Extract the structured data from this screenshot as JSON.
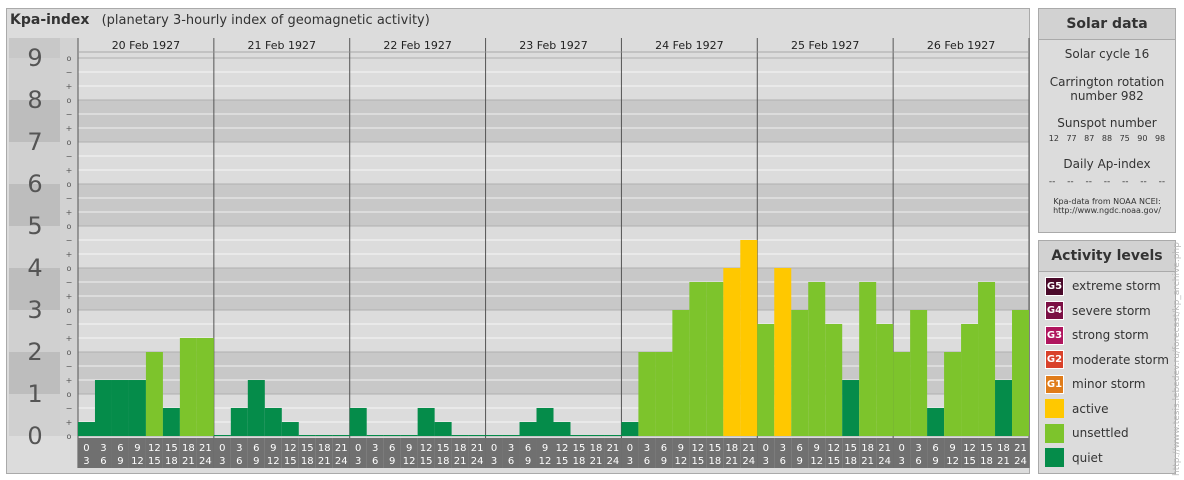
{
  "header": {
    "title": "Kpa-index",
    "subtitle": "(planetary 3-hourly index of geomagnetic activity)"
  },
  "chart_data": {
    "type": "bar",
    "ylim": [
      0,
      9
    ],
    "y_major_ticks": [
      "0",
      "1",
      "2",
      "3",
      "4",
      "5",
      "6",
      "7",
      "8",
      "9"
    ],
    "y_minor_ticks": [
      "o",
      "+",
      "−"
    ],
    "days": [
      "20 Feb 1927",
      "21 Feb 1927",
      "22 Feb 1927",
      "23 Feb 1927",
      "24 Feb 1927",
      "25 Feb 1927",
      "26 Feb 1927"
    ],
    "interval_starts": [
      "0",
      "3",
      "6",
      "9",
      "12",
      "15",
      "18",
      "21"
    ],
    "interval_ends": [
      "3",
      "6",
      "9",
      "12",
      "15",
      "18",
      "21",
      "24"
    ],
    "values": [
      [
        0.333,
        1.333,
        1.333,
        1.333,
        2.0,
        0.667,
        2.333,
        2.333
      ],
      [
        0.0,
        0.667,
        1.333,
        0.667,
        0.333,
        0.0,
        0.0,
        0.0
      ],
      [
        0.667,
        0.0,
        0.0,
        0.0,
        0.667,
        0.333,
        0.0,
        0.0
      ],
      [
        0.0,
        0.0,
        0.333,
        0.667,
        0.333,
        0.0,
        0.0,
        0.0
      ],
      [
        0.333,
        2.0,
        2.0,
        3.0,
        3.667,
        3.667,
        4.0,
        4.667
      ],
      [
        2.667,
        4.0,
        3.0,
        3.667,
        2.667,
        1.333,
        3.667,
        2.667
      ],
      [
        2.0,
        3.0,
        0.667,
        2.0,
        2.667,
        3.667,
        1.333,
        3.0
      ]
    ],
    "colors": {
      "quiet": "#058c4a",
      "unsettled": "#7dc42c",
      "active": "#ffc800",
      "g1": "#e07c1a",
      "g2": "#d9412a",
      "g3": "#b0155e",
      "g4": "#7b0f44",
      "g5": "#4a0a2a"
    }
  },
  "solar": {
    "title": "Solar data",
    "cycle": "Solar cycle 16",
    "carrington_line1": "Carrington rotation",
    "carrington_line2": "number 982",
    "sunspot_label": "Sunspot number",
    "sunspot_values": [
      "12",
      "77",
      "87",
      "88",
      "75",
      "90",
      "98"
    ],
    "ap_label": "Daily Ap-index",
    "ap_values": [
      "--",
      "--",
      "--",
      "--",
      "--",
      "--",
      "--"
    ],
    "source_line1": "Kpa-data from NOAA NCEI:",
    "source_line2": "http://www.ngdc.noaa.gov/"
  },
  "activity": {
    "title": "Activity levels",
    "levels": [
      {
        "code": "G5",
        "label": "extreme storm",
        "color": "#4a0a2a"
      },
      {
        "code": "G4",
        "label": "severe storm",
        "color": "#7b0f44"
      },
      {
        "code": "G3",
        "label": "strong storm",
        "color": "#b0155e"
      },
      {
        "code": "G2",
        "label": "moderate storm",
        "color": "#d9412a"
      },
      {
        "code": "G1",
        "label": "minor storm",
        "color": "#e07c1a"
      },
      {
        "code": "",
        "label": "active",
        "color": "#ffc800"
      },
      {
        "code": "",
        "label": "unsettled",
        "color": "#7dc42c"
      },
      {
        "code": "",
        "label": "quiet",
        "color": "#058c4a"
      }
    ]
  },
  "footer": {
    "vertical_url": "http://www.tesis.lebedev.ru/forecast/kp_archive.php"
  }
}
